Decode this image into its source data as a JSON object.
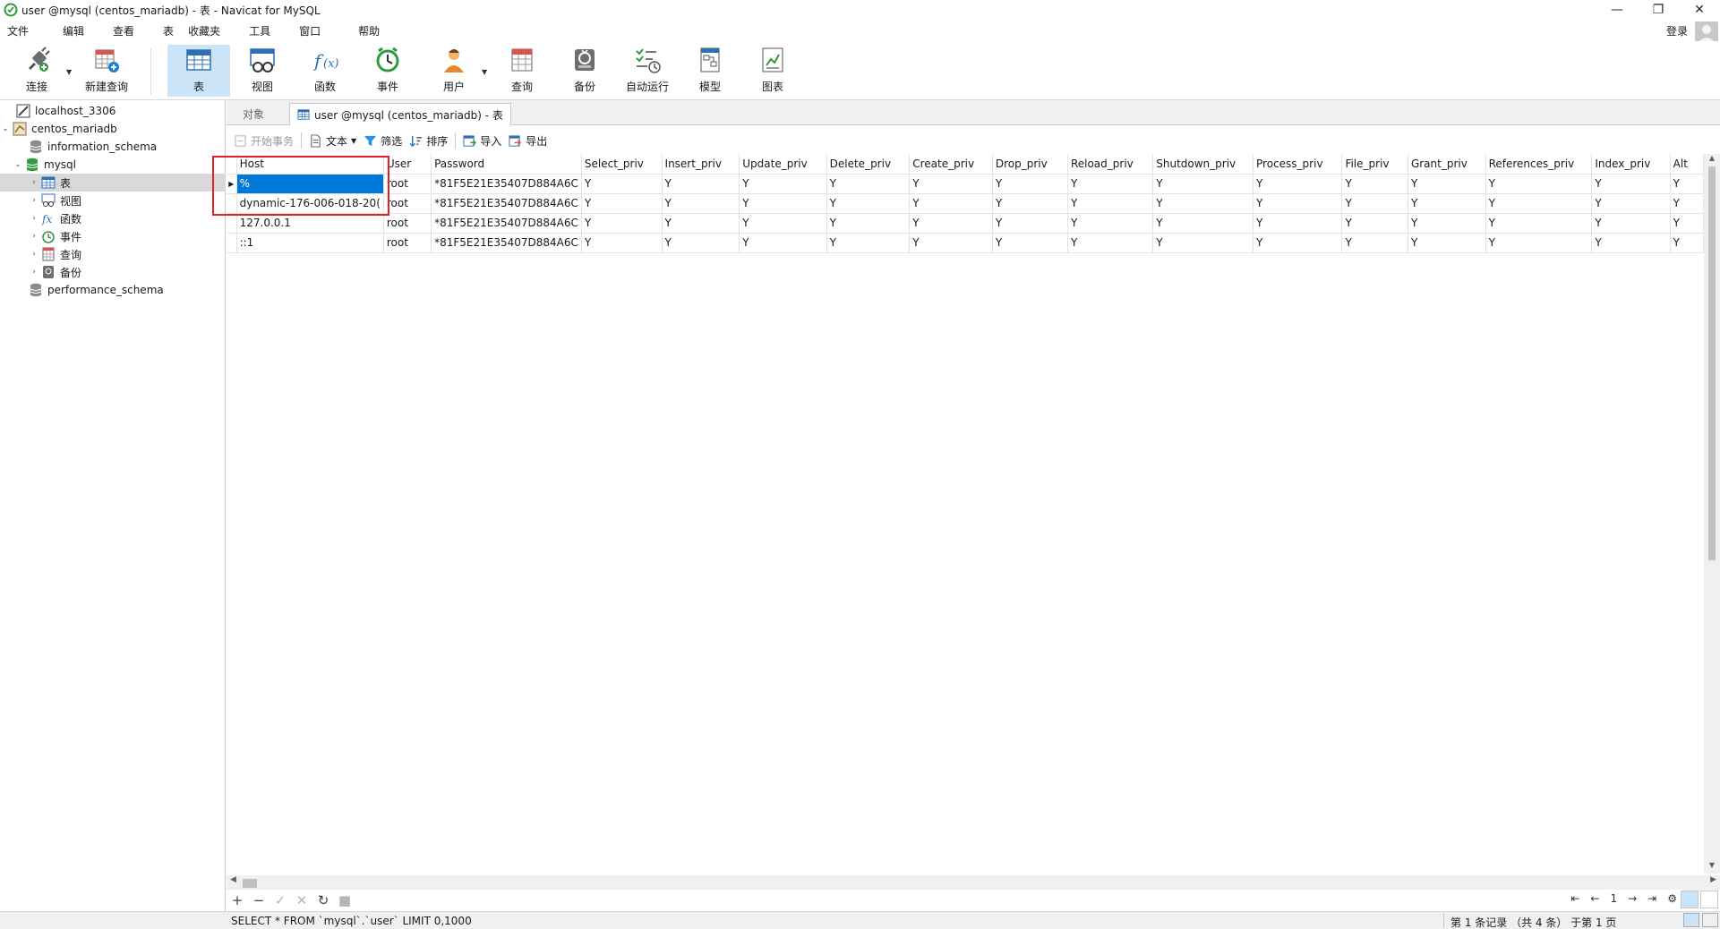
{
  "window": {
    "title": "user @mysql (centos_mariadb) - 表 - Navicat for MySQL",
    "controls": [
      "—",
      "❐",
      "✕"
    ]
  },
  "menu": {
    "items": [
      "文件",
      "编辑",
      "查看",
      "表",
      "收藏夹",
      "工具",
      "窗口",
      "帮助"
    ],
    "login": "登录"
  },
  "toolbar": {
    "connect": "连接",
    "new_query": "新建查询",
    "table": "表",
    "view": "视图",
    "function": "函数",
    "event": "事件",
    "user": "用户",
    "query": "查询",
    "backup": "备份",
    "autorun": "自动运行",
    "model": "模型",
    "chart": "图表"
  },
  "tree": {
    "conn1": "localhost_3306",
    "conn2": "centos_mariadb",
    "db1": "information_schema",
    "db2": "mysql",
    "c_tables": "表",
    "c_views": "视图",
    "c_functions": "函数",
    "c_events": "事件",
    "c_queries": "查询",
    "c_backups": "备份",
    "db3": "performance_schema"
  },
  "tabs": {
    "objects": "对象",
    "current": "user @mysql (centos_mariadb) - 表"
  },
  "subtoolbar": {
    "begin_tx": "开始事务",
    "text": "文本",
    "filter": "筛选",
    "sort": "排序",
    "import": "导入",
    "export": "导出"
  },
  "grid": {
    "columns": [
      "Host",
      "User",
      "Password",
      "Select_priv",
      "Insert_priv",
      "Update_priv",
      "Delete_priv",
      "Create_priv",
      "Drop_priv",
      "Reload_priv",
      "Shutdown_priv",
      "Process_priv",
      "File_priv",
      "Grant_priv",
      "References_priv",
      "Index_priv",
      "Alt"
    ],
    "rows": [
      [
        "%",
        "root",
        "*81F5E21E35407D884A6C",
        "Y",
        "Y",
        "Y",
        "Y",
        "Y",
        "Y",
        "Y",
        "Y",
        "Y",
        "Y",
        "Y",
        "Y",
        "Y",
        "Y"
      ],
      [
        "dynamic-176-006-018-20(",
        "root",
        "*81F5E21E35407D884A6C",
        "Y",
        "Y",
        "Y",
        "Y",
        "Y",
        "Y",
        "Y",
        "Y",
        "Y",
        "Y",
        "Y",
        "Y",
        "Y",
        "Y"
      ],
      [
        "127.0.0.1",
        "root",
        "*81F5E21E35407D884A6C",
        "Y",
        "Y",
        "Y",
        "Y",
        "Y",
        "Y",
        "Y",
        "Y",
        "Y",
        "Y",
        "Y",
        "Y",
        "Y",
        "Y"
      ],
      [
        "::1",
        "root",
        "*81F5E21E35407D884A6C",
        "Y",
        "Y",
        "Y",
        "Y",
        "Y",
        "Y",
        "Y",
        "Y",
        "Y",
        "Y",
        "Y",
        "Y",
        "Y",
        "Y"
      ]
    ]
  },
  "nav": {
    "add": "+",
    "remove": "−",
    "apply": "✓",
    "cancel": "✕",
    "refresh": "↻",
    "stop": "■",
    "first": "⇤",
    "prev": "←",
    "page": "1",
    "next": "→",
    "last": "⇥",
    "settings": "⚙"
  },
  "status": {
    "sql": "SELECT * FROM `mysql`.`user` LIMIT 0,1000",
    "record": "第 1 条记录 （共 4 条） 于第 1 页"
  },
  "colors": {
    "selection": "#0078d7",
    "active_tool": "#cce4f7",
    "highlight_box": "#e0202a"
  }
}
